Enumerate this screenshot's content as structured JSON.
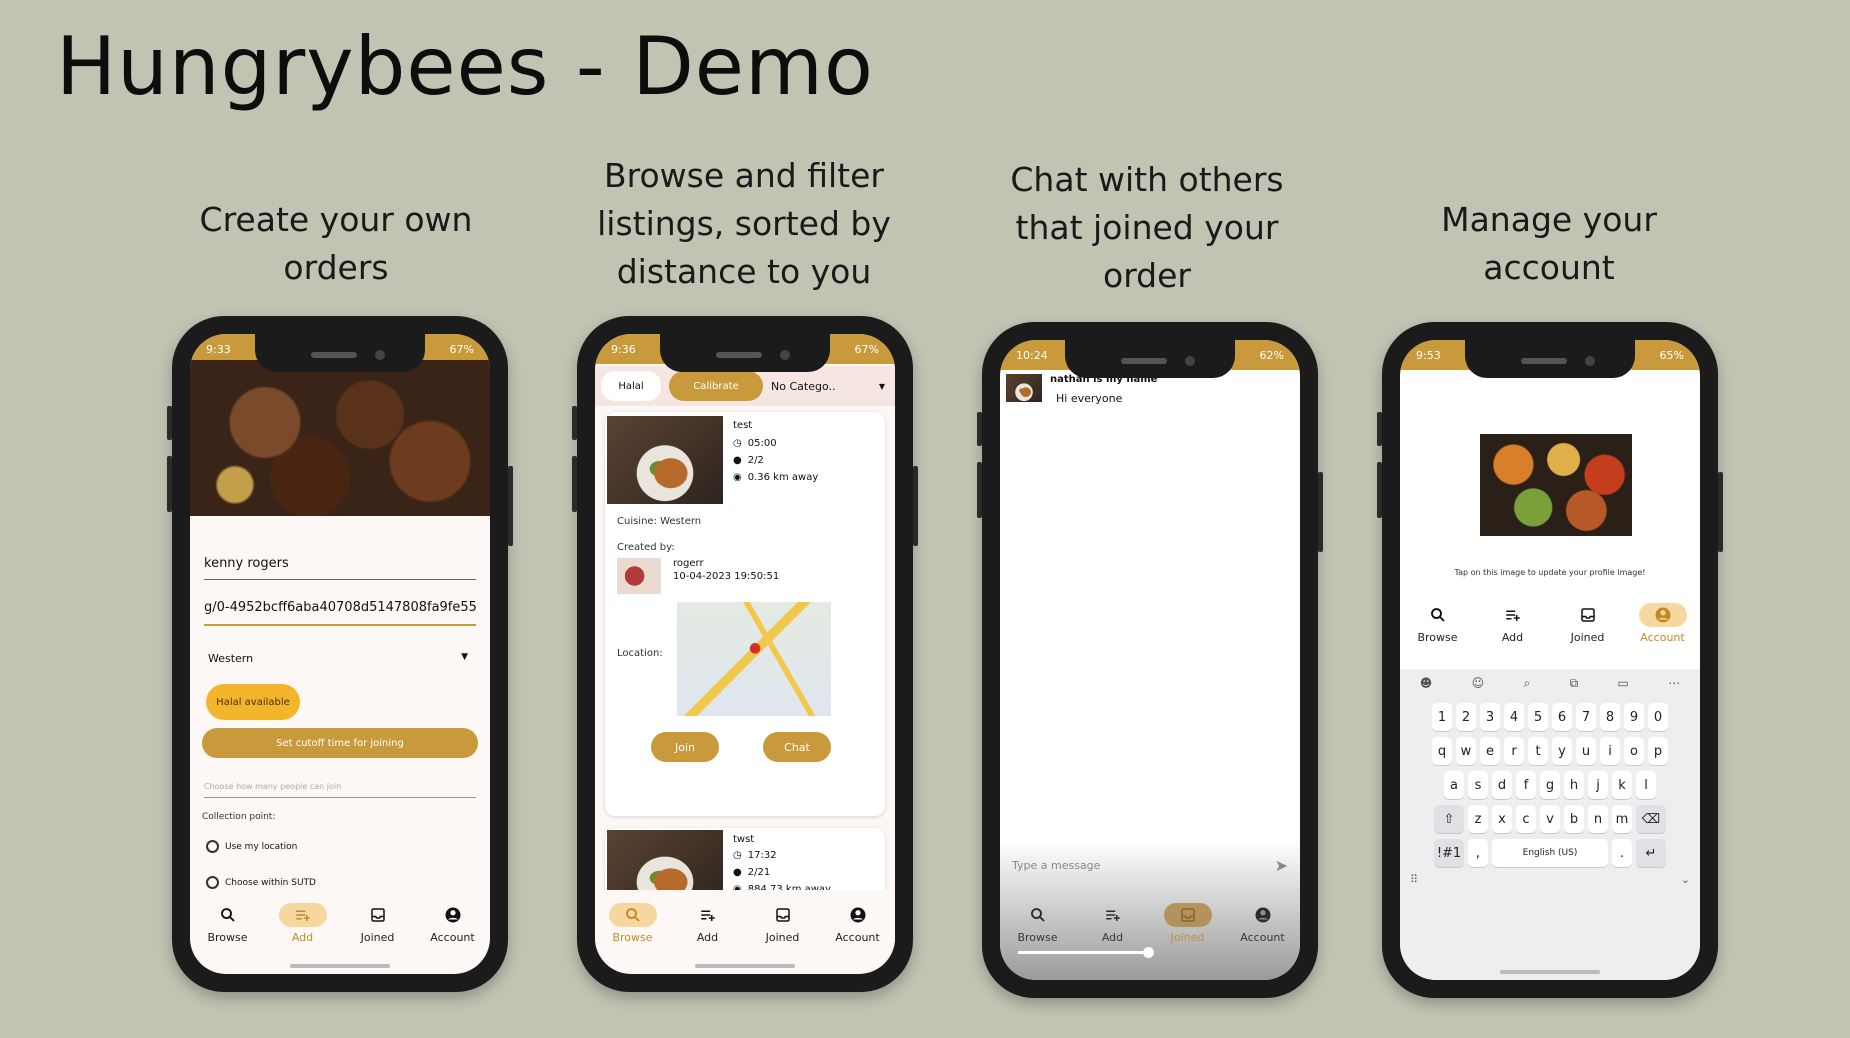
{
  "title": "Hungrybees - Demo",
  "captions": {
    "c1": "Create your own orders",
    "c2": "Browse and filter listings, sorted by distance to you",
    "c3": "Chat with others that joined your order",
    "c4": "Manage your account"
  },
  "nav": {
    "browse": "Browse",
    "add": "Add",
    "joined": "Joined",
    "account": "Account"
  },
  "phone1": {
    "status_time": "9:33",
    "status_right": "67%",
    "name_value": "kenny rogers",
    "url_value": "g/0-4952bcff6aba40708d5147808fa9fe55",
    "cuisine_select": "Western",
    "halal_button": "Halal available",
    "cutoff_button": "Set cutoff time for joining",
    "people_placeholder": "Choose how many people can join",
    "collection_label": "Collection point:",
    "radio1": "Use my location",
    "radio2": "Choose within SUTD"
  },
  "phone2": {
    "status_time": "9:36",
    "status_right": "67%",
    "filter_halal": "Halal",
    "filter_calibrate": "Calibrate",
    "filter_category": "No Catego..",
    "card1": {
      "name": "test",
      "time": "05:00",
      "people": "2/2",
      "distance": "0.36 km away",
      "cuisine": "Cuisine: Western",
      "created_by": "Created by:",
      "creator": "rogerr",
      "created_at": "10-04-2023 19:50:51",
      "location_label": "Location:",
      "join": "Join",
      "chat": "Chat"
    },
    "card2": {
      "name": "twst",
      "time": "17:32",
      "people": "2/21",
      "distance": "884.73 km away"
    }
  },
  "phone3": {
    "status_time": "10:24",
    "status_right": "62%",
    "sender": "nathan is my name",
    "message": "Hi everyone",
    "input_placeholder": "Type a message"
  },
  "phone4": {
    "status_time": "9:53",
    "status_right": "65%",
    "profile_hint": "Tap on this image to update your profile image!",
    "kb_row1": [
      "1",
      "2",
      "3",
      "4",
      "5",
      "6",
      "7",
      "8",
      "9",
      "0"
    ],
    "kb_row2": [
      "q",
      "w",
      "e",
      "r",
      "t",
      "y",
      "u",
      "i",
      "o",
      "p"
    ],
    "kb_row3": [
      "a",
      "s",
      "d",
      "f",
      "g",
      "h",
      "j",
      "k",
      "l"
    ],
    "kb_row4": [
      "z",
      "x",
      "c",
      "v",
      "b",
      "n",
      "m"
    ],
    "kb_sym": "!#1",
    "kb_comma": ",",
    "kb_space": "English (US)",
    "kb_period": "."
  },
  "colors": {
    "accent": "#c89a3b",
    "background": "#c2c3b3",
    "active_pill": "#f6d7a0"
  }
}
